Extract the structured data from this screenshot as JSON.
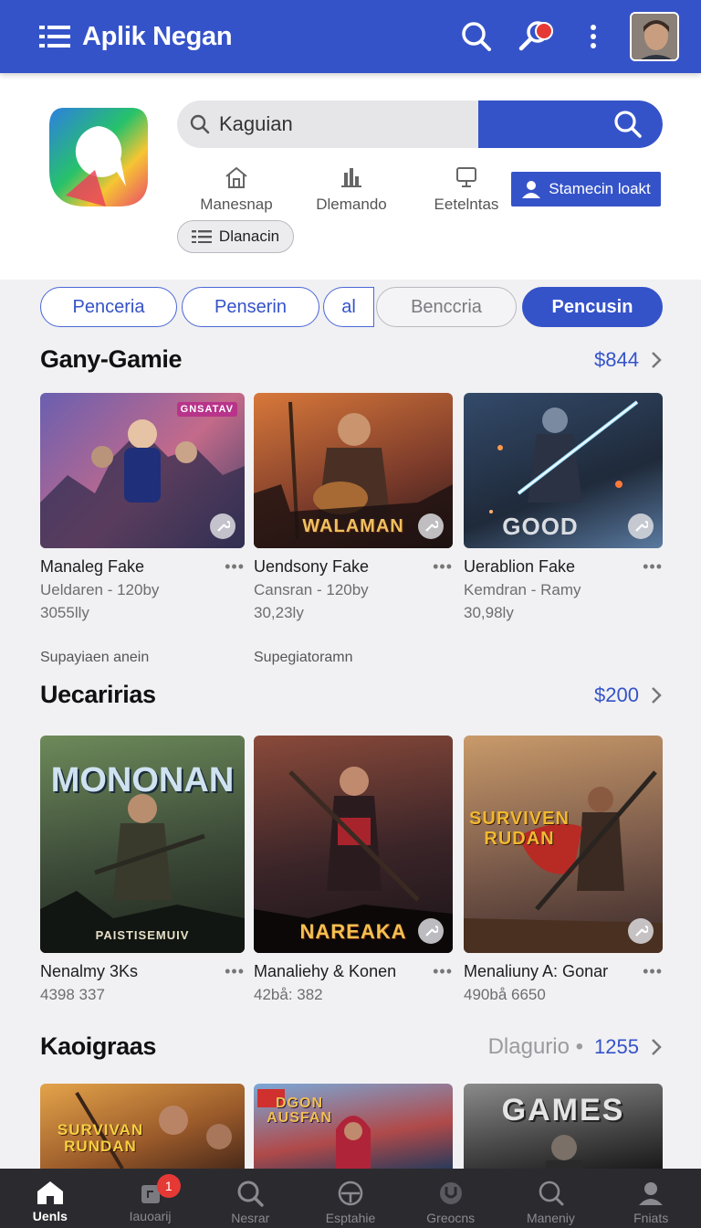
{
  "app": {
    "title": "Aplik Negan"
  },
  "search": {
    "value": "Kaguian"
  },
  "quick_nav": [
    {
      "label": "Manesnap",
      "icon": "home-icon"
    },
    {
      "label": "Dlemando",
      "icon": "chart-icon"
    },
    {
      "label": "Eetelntas",
      "icon": "monitor-icon"
    }
  ],
  "cta_label": "Stamecin loakt",
  "chip_label": "Dlanacin",
  "tabs": [
    {
      "label": "Penceria",
      "state": "outline"
    },
    {
      "label": "Penserin",
      "state": "outline"
    },
    {
      "label": "al",
      "state": "outline"
    },
    {
      "label": "Benccria",
      "state": "grey"
    },
    {
      "label": "Pencusin",
      "state": "active"
    }
  ],
  "sections": [
    {
      "title": "Gany-Gamie",
      "subtitle": "",
      "count": "$844",
      "items": [
        {
          "name": "Manaleg Fake",
          "meta1": "Ueldaren - 120by",
          "meta2": "3055lly",
          "extra": "Supayiaen anein",
          "art_text": "GNSATAV",
          "colors": [
            "#6a5fb0",
            "#c46a8a",
            "#3a3f66"
          ]
        },
        {
          "name": "Uendsony Fake",
          "meta1": "Cansran - 120by",
          "meta2": "30,23ly",
          "extra": "Supegiatoramn",
          "art_text": "WALAMAN",
          "colors": [
            "#d8783a",
            "#7a3a2a",
            "#2a1c1a"
          ]
        },
        {
          "name": "Uerablion Fake",
          "meta1": "Kemdran - Ramy",
          "meta2": "30,98ly",
          "extra": "",
          "art_text": "GOOD",
          "colors": [
            "#334a6a",
            "#1f2a3a",
            "#5a7aa0"
          ]
        }
      ]
    },
    {
      "title": "Uecaririas",
      "subtitle": "",
      "count": "$200",
      "items": [
        {
          "name": "Nenalmy 3Ks",
          "meta1": "4398 337",
          "art_text": "MONONAN",
          "art_sub": "PAISTISEMUIV",
          "colors": [
            "#6d8a5a",
            "#3c4a38",
            "#1d231c"
          ]
        },
        {
          "name": "Manaliehy & Konen",
          "meta1": "42bå: 382",
          "art_text": "NAREAKA",
          "colors": [
            "#8a4a3a",
            "#3a2428",
            "#1a1418"
          ]
        },
        {
          "name": "Menaliuny A: Gonar",
          "meta1": "490bå 6650",
          "art_text": "SURVIVEN RUDAN",
          "colors": [
            "#c99a6a",
            "#7a5a4a",
            "#3a2a2a"
          ]
        }
      ]
    },
    {
      "title": "Kaoigraas",
      "subtitle": "Dlagurio •",
      "count": "1255",
      "items": [
        {
          "art_text": "SURVIVAN RUNDAN",
          "colors": [
            "#e4a44a",
            "#9a5a2a",
            "#4a2a1a"
          ]
        },
        {
          "art_text": "DGON AUSFAN",
          "colors": [
            "#7aa8d8",
            "#b04a4a",
            "#2a3a5a"
          ]
        },
        {
          "art_text": "GAMES",
          "colors": [
            "#8a8a8a",
            "#4a4a4a",
            "#1a1a1a"
          ]
        }
      ]
    }
  ],
  "bottom_nav": [
    {
      "label": "Uenls",
      "icon": "home-icon",
      "active": true
    },
    {
      "label": "Iauoarij",
      "icon": "library-icon",
      "badge": "1"
    },
    {
      "label": "Nesrar",
      "icon": "search-icon"
    },
    {
      "label": "Esptahie",
      "icon": "gauge-icon"
    },
    {
      "label": "Greocns",
      "icon": "target-icon"
    },
    {
      "label": "Maneniy",
      "icon": "magnifier-icon"
    },
    {
      "label": "Fniats",
      "icon": "profile-icon"
    }
  ]
}
